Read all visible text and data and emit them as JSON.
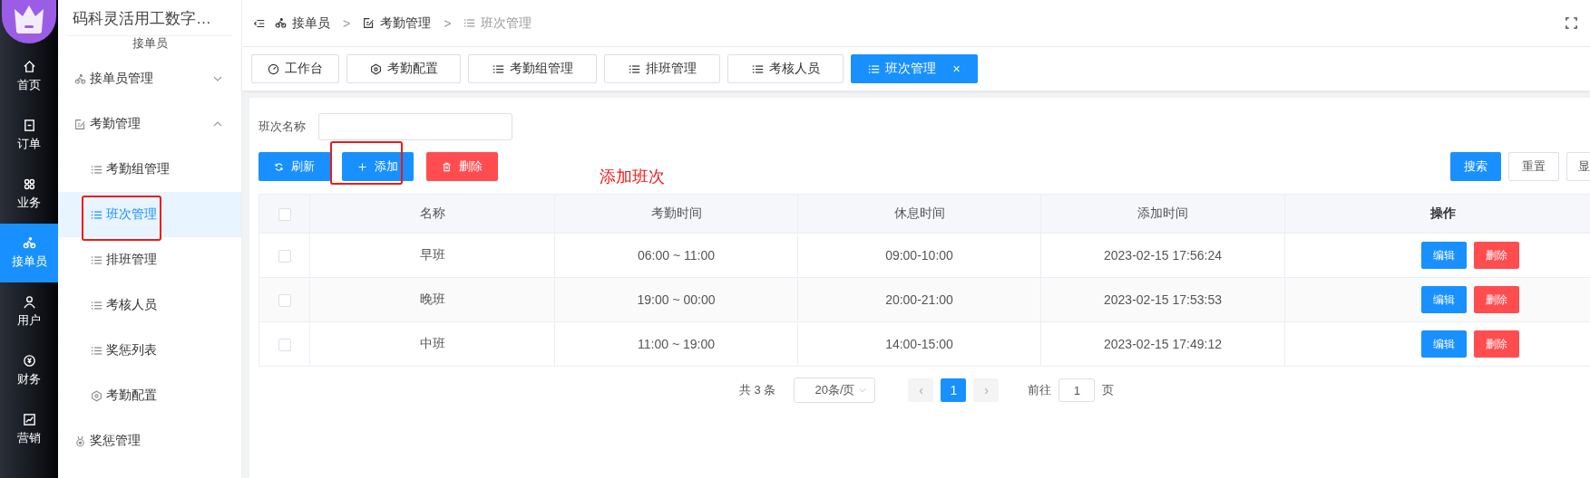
{
  "nav": [
    {
      "label": "首页",
      "selected": false
    },
    {
      "label": "订单",
      "selected": false
    },
    {
      "label": "业务",
      "selected": false
    },
    {
      "label": "接单员",
      "selected": true
    },
    {
      "label": "用户",
      "selected": false
    },
    {
      "label": "财务",
      "selected": false
    },
    {
      "label": "营销",
      "selected": false
    }
  ],
  "sidebar": {
    "title": "码科灵活用工数字…",
    "section": "接单员",
    "items": [
      {
        "label": "接单员管理",
        "expanded": false
      },
      {
        "label": "考勤管理",
        "expanded": true,
        "children": [
          {
            "label": "考勤组管理",
            "selected": false,
            "annotated": false
          },
          {
            "label": "班次管理",
            "selected": true,
            "annotated": true
          },
          {
            "label": "排班管理",
            "selected": false,
            "annotated": false
          },
          {
            "label": "考核人员",
            "selected": false,
            "annotated": false
          },
          {
            "label": "奖惩列表",
            "selected": false,
            "annotated": false
          },
          {
            "label": "考勤配置",
            "selected": false,
            "annotated": false
          }
        ]
      },
      {
        "label": "奖惩管理"
      }
    ]
  },
  "breadcrumb": [
    {
      "label": "接单员",
      "current": false
    },
    {
      "label": "考勤管理",
      "current": false
    },
    {
      "label": "班次管理",
      "current": true
    }
  ],
  "breadcrumb_separator": ">",
  "tabs": [
    {
      "label": "工作台",
      "selected": false
    },
    {
      "label": "考勤配置",
      "selected": false
    },
    {
      "label": "考勤组管理",
      "selected": false
    },
    {
      "label": "排班管理",
      "selected": false
    },
    {
      "label": "考核人员",
      "selected": false
    },
    {
      "label": "班次管理",
      "selected": true
    }
  ],
  "tab_close": "×",
  "search": {
    "label": "班次名称"
  },
  "toolbar": [
    {
      "label": "刷新",
      "kind": "primary",
      "annotated": false
    },
    {
      "label": "添加",
      "kind": "primary",
      "annotated": true
    },
    {
      "label": "删除",
      "kind": "danger",
      "annotated": false
    }
  ],
  "annotation": "添加班次",
  "right_buttons": [
    {
      "label": "搜索",
      "kind": "primary"
    },
    {
      "label": "重置",
      "kind": "plain"
    },
    {
      "label": "显",
      "kind": "plain"
    }
  ],
  "table": {
    "columns": [
      "名称",
      "考勤时间",
      "休息时间",
      "添加时间",
      "操作"
    ],
    "select_all_checked": false,
    "rows": [
      {
        "checked": false,
        "cells": [
          "早班",
          "06:00 ~ 11:00",
          "09:00-10:00",
          "2023-02-15 17:56:24"
        ],
        "actions": [
          "编辑",
          "删除"
        ]
      },
      {
        "checked": false,
        "cells": [
          "晚班",
          "19:00 ~ 00:00",
          "20:00-21:00",
          "2023-02-15 17:53:53"
        ],
        "actions": [
          "编辑",
          "删除"
        ]
      },
      {
        "checked": false,
        "cells": [
          "中班",
          "11:00 ~ 19:00",
          "14:00-15:00",
          "2023-02-15 17:49:12"
        ],
        "actions": [
          "编辑",
          "删除"
        ]
      }
    ]
  },
  "pagination": {
    "total": "共 3 条",
    "page_size": "20条/页",
    "prev": "‹",
    "pages": [
      {
        "label": "1",
        "selected": true
      }
    ],
    "next": "›",
    "goto_label": "前往",
    "goto_value": "1",
    "goto_suffix": "页"
  }
}
